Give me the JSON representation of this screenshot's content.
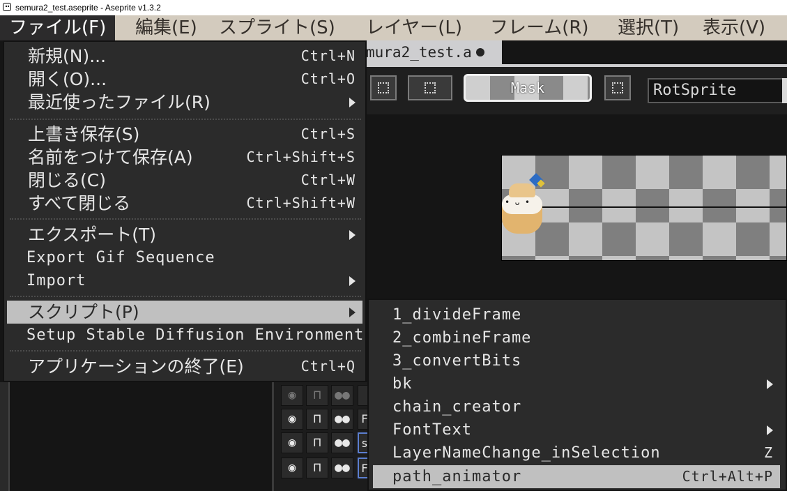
{
  "window": {
    "title": "semura2_test.aseprite - Aseprite v1.3.2"
  },
  "menubar": {
    "items": [
      {
        "label": "ファイル(F)"
      },
      {
        "label": "編集(E)"
      },
      {
        "label": "スプライト(S)"
      },
      {
        "label": "レイヤー(L)"
      },
      {
        "label": "フレーム(R)"
      },
      {
        "label": "選択(T)"
      },
      {
        "label": "表示(V)"
      }
    ],
    "active_index": 0
  },
  "document_tab": {
    "label": "mura2_test.a"
  },
  "toolbar": {
    "mask_label": "Mask",
    "rotation_algorithm": "RotSprite"
  },
  "file_menu": {
    "items": [
      {
        "label": "新規(N)...",
        "shortcut": "Ctrl+N"
      },
      {
        "label": "開く(O)...",
        "shortcut": "Ctrl+O"
      },
      {
        "label": "最近使ったファイル(R)",
        "submenu": true
      },
      {
        "label": "上書き保存(S)",
        "shortcut": "Ctrl+S"
      },
      {
        "label": "名前をつけて保存(A)",
        "shortcut": "Ctrl+Shift+S"
      },
      {
        "label": "閉じる(C)",
        "shortcut": "Ctrl+W"
      },
      {
        "label": "すべて閉じる",
        "shortcut": "Ctrl+Shift+W"
      },
      {
        "label": "エクスポート(T)",
        "submenu": true
      },
      {
        "label": "Export Gif Sequence"
      },
      {
        "label": "Import",
        "submenu": true
      },
      {
        "label": "スクリプト(P)",
        "submenu": true,
        "highlighted": true
      },
      {
        "label": "Setup Stable Diffusion Environment"
      },
      {
        "label": "アプリケーションの終了(E)",
        "shortcut": "Ctrl+Q"
      }
    ]
  },
  "scripts_submenu": {
    "items": [
      {
        "label": "1_divideFrame"
      },
      {
        "label": "2_combineFrame"
      },
      {
        "label": "3_convertBits"
      },
      {
        "label": "bk",
        "submenu": true
      },
      {
        "label": "chain_creator"
      },
      {
        "label": "FontText",
        "submenu": true
      },
      {
        "label": "LayerNameChange_inSelection",
        "shortcut": "Z"
      },
      {
        "label": "path_animator",
        "shortcut": "Ctrl+Alt+P",
        "highlighted": true
      }
    ]
  },
  "timeline": {
    "layer_name_initials": [
      "s",
      "F",
      "s",
      "F"
    ]
  },
  "colors": {
    "menubar_bg": "#d3cbbe",
    "menu_bg": "#2b2b2b",
    "menu_highlight": "#c0c0c0",
    "checker_dark": "#7f7f7f",
    "checker_light": "#c4c4c4"
  }
}
